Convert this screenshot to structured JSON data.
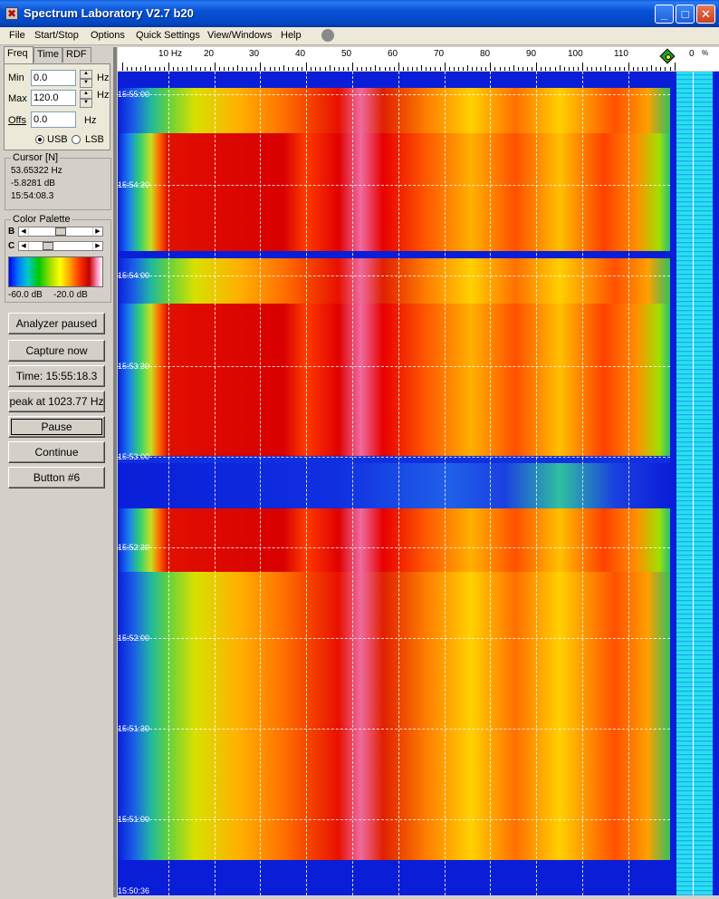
{
  "window": {
    "title": "Spectrum Laboratory V2.7 b20",
    "minimize_label": "_",
    "maximize_label": "□",
    "close_label": "✕",
    "icon_glyph": "✖"
  },
  "menu": {
    "items": [
      "File",
      "Start/Stop",
      "Options",
      "Quick Settings",
      "View/Windows",
      "Help"
    ]
  },
  "tabs": [
    "Freq",
    "Time",
    "RDF"
  ],
  "freq_settings": {
    "min_label": "Min",
    "min_value": "0.0",
    "max_label": "Max",
    "max_value": "120.0",
    "offs_label": "Offs",
    "offs_value": "0.0",
    "unit": "Hz",
    "usb_label": "USB",
    "lsb_label": "LSB",
    "selected_mode": "USB"
  },
  "cursor": {
    "title": "Cursor [N]",
    "frequency": "53.65322 Hz",
    "level": "-5.8281 dB",
    "time": "15:54:08.3"
  },
  "color_palette": {
    "title": "Color Palette",
    "b_label": "B",
    "c_label": "C",
    "min_label": "-60.0 dB",
    "max_label": "-20.0 dB"
  },
  "buttons": {
    "analyzer": "Analyzer paused",
    "capture": "Capture now",
    "time": "Time:  15:55:18.3",
    "peak": "peak at 1023.77 Hz",
    "pause": "Pause",
    "continue": "Continue",
    "button6": "Button #6"
  },
  "freq_axis": {
    "labels": [
      "10 Hz",
      "20",
      "30",
      "40",
      "50",
      "60",
      "70",
      "80",
      "90",
      "100",
      "110"
    ],
    "right_labels": [
      "0",
      "%"
    ]
  },
  "timestamps": [
    "15:55:00",
    "15:54:30",
    "15:54:00",
    "15:53:30",
    "15:53:00",
    "15:52:30",
    "15:52:00",
    "15:51:30",
    "15:51:00",
    "15:50:36"
  ],
  "colors": {
    "title_bar": "#0752d8",
    "waterfall_background": "#0a1ed8",
    "level_meter": "#28e0f0"
  }
}
